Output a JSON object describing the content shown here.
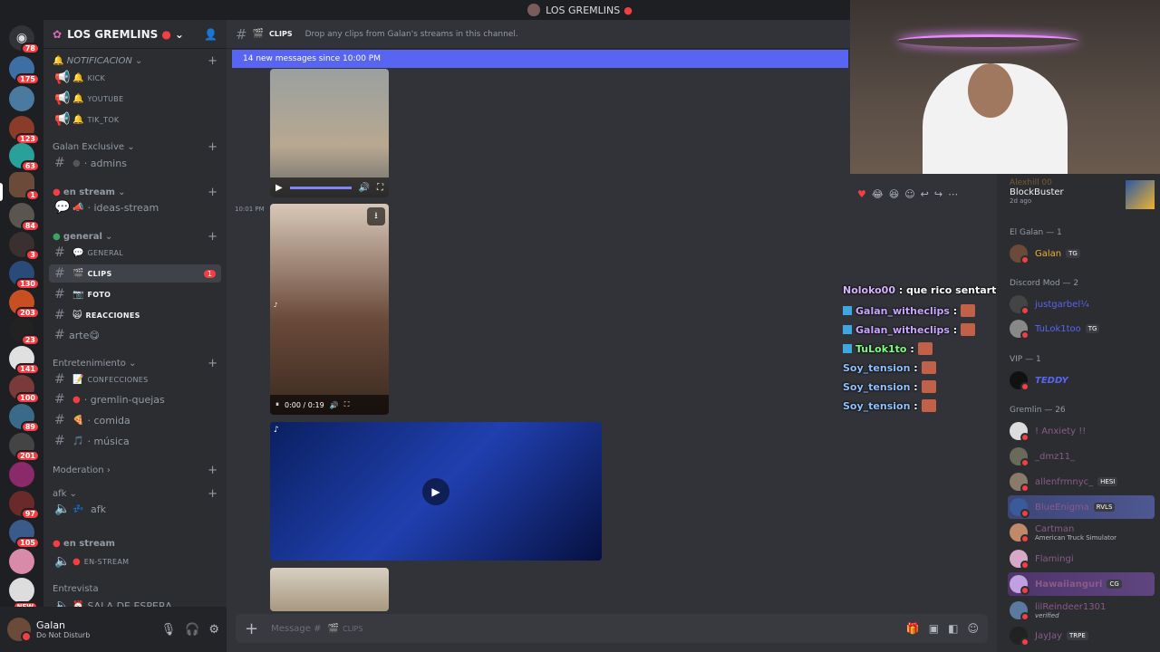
{
  "titlebar": {
    "title": "LOS GREMLINS"
  },
  "servers": [
    {
      "badge": "78"
    },
    {
      "badge": "175"
    },
    {
      "badge": ""
    },
    {
      "badge": "123"
    },
    {
      "badge": "63"
    },
    {
      "badge": "1"
    },
    {
      "badge": "84"
    },
    {
      "badge": "3"
    },
    {
      "badge": "130"
    },
    {
      "badge": "203"
    },
    {
      "badge": "23"
    },
    {
      "badge": "141"
    },
    {
      "badge": "100"
    },
    {
      "badge": "89"
    },
    {
      "badge": "201"
    },
    {
      "badge": ""
    },
    {
      "badge": "97"
    },
    {
      "badge": "105"
    },
    {
      "badge": ""
    },
    {
      "badge": "NEW"
    }
  ],
  "sidebar": {
    "server_name": "LOS GREMLINS",
    "categories": [
      {
        "label": "NOTIFICACION"
      },
      {
        "label": "Galan Exclusive"
      },
      {
        "label": "en stream"
      },
      {
        "label": "general"
      },
      {
        "label": "Entretenimiento"
      },
      {
        "label": "Moderation"
      },
      {
        "label": "afk"
      },
      {
        "label": "en stream"
      },
      {
        "label": "Entrevista"
      }
    ],
    "channels": [
      {
        "label": "KICK"
      },
      {
        "label": "YOUTUBE"
      },
      {
        "label": "TIK_TOK"
      },
      {
        "label": "admins"
      },
      {
        "label": "ideas-stream"
      },
      {
        "label": "GENERAL"
      },
      {
        "label": "CLIPS",
        "badge": "1"
      },
      {
        "label": "FOTO"
      },
      {
        "label": "REACCIONES"
      },
      {
        "label": "arte"
      },
      {
        "label": "CONFECCIONES"
      },
      {
        "label": "gremlin-quejas"
      },
      {
        "label": "comida"
      },
      {
        "label": "música"
      },
      {
        "label": "afk"
      },
      {
        "label": "EN-STREAM"
      },
      {
        "label": "SALA DE ESPERA"
      }
    ]
  },
  "user": {
    "name": "Galan",
    "status": "Do Not Disturb"
  },
  "main": {
    "channel": "CLIPS",
    "topic": "Drop any clips from Galan's streams in this channel.",
    "new_messages": "14 new messages since 10:00 PM",
    "timestamp": "10:01 PM",
    "video_time": "0:00 / 0:19",
    "composer_placeholder": "Message #",
    "composer_channel": "CLIPS"
  },
  "overlay_chat": [
    {
      "user": "Noloko00",
      "text": ": que rico sentarte en ese pepino si o no galán",
      "color": "#d7b4ff"
    },
    {
      "user": "Galan_witheclips",
      "text": ":",
      "color": "#c9a6ff"
    },
    {
      "user": "Galan_witheclips",
      "text": ":",
      "color": "#c9a6ff"
    },
    {
      "user": "TuLok1to",
      "text": ":",
      "color": "#7cff7c"
    },
    {
      "user": "Soy_tension",
      "text": ":",
      "color": "#8fc1ff"
    },
    {
      "user": "Soy_tension",
      "text": ":",
      "color": "#8fc1ff"
    },
    {
      "user": "Soy_tension",
      "text": ":",
      "color": "#8fc1ff"
    }
  ],
  "members": {
    "top_item": {
      "name": "Alexhill 00",
      "title": "BlockBuster",
      "sub": "2d ago"
    },
    "cats": [
      "El Galan — 1",
      "Discord Mod — 2",
      "VIP — 1",
      "Gremlin — 26"
    ],
    "list": [
      {
        "name": "Galan",
        "tag": "TG",
        "color": "#f0b232"
      },
      {
        "name": "justgarbel¼",
        "tag": "",
        "color": "#5865f2"
      },
      {
        "name": "TuLok1too",
        "tag": "TG",
        "color": "#5865f2"
      },
      {
        "name": "TEDDY",
        "tag": "",
        "color": "#5865f2"
      },
      {
        "name": "! Anxiety !!",
        "tag": "",
        "color": "#8b5a8a"
      },
      {
        "name": "_dmz11_",
        "tag": "",
        "color": "#8b5a8a"
      },
      {
        "name": "allenfrmnyc_",
        "tag": "HESI",
        "color": "#8b5a8a"
      },
      {
        "name": "BlueEnigma",
        "tag": "RVLS",
        "color": "#8b5a8a"
      },
      {
        "name": "Cartman",
        "tag": "",
        "sub": "American Truck Simulator",
        "color": "#8b5a8a"
      },
      {
        "name": "Flamingi",
        "tag": "",
        "color": "#8b5a8a"
      },
      {
        "name": "Hawaiianguri",
        "tag": "CG",
        "color": "#8b5a8a"
      },
      {
        "name": "lilReindeer1301",
        "tag": "",
        "sub": "verified",
        "color": "#8b5a8a"
      },
      {
        "name": "JayJay",
        "tag": "TRPE",
        "color": "#8b5a8a"
      }
    ]
  }
}
